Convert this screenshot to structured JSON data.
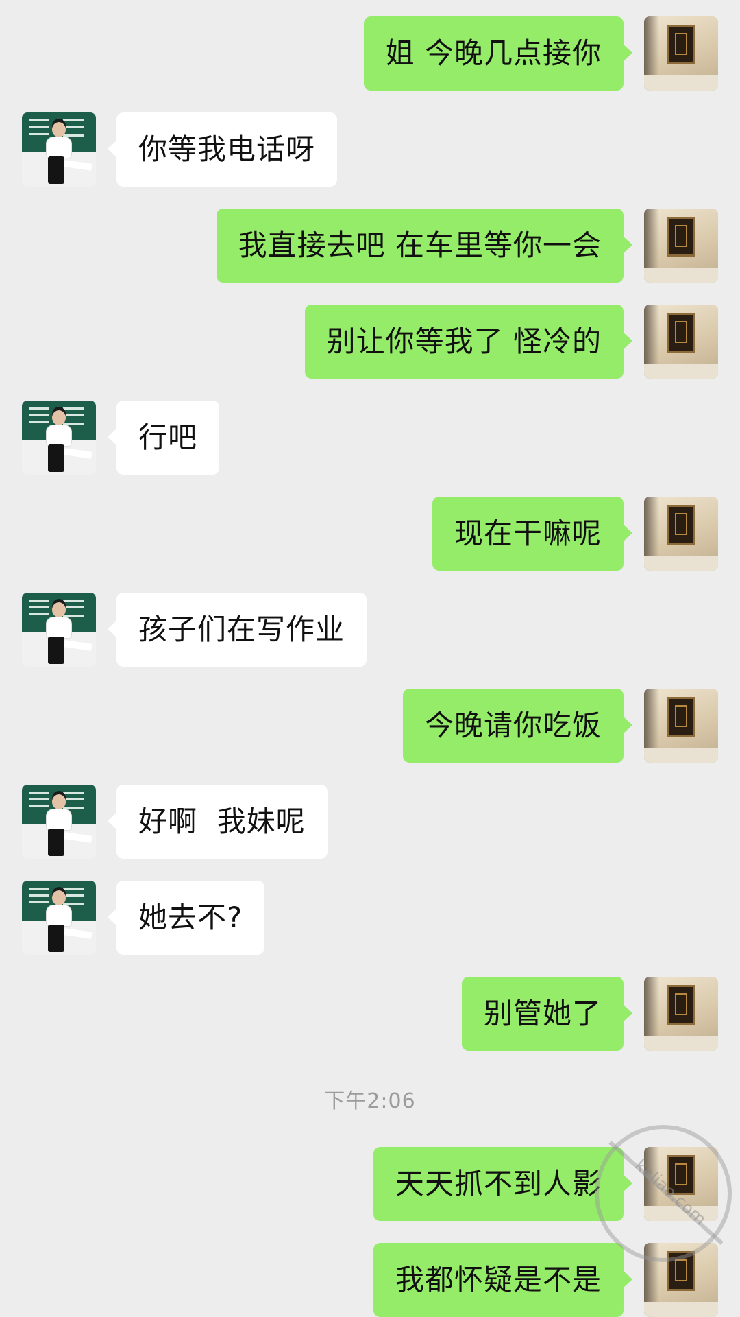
{
  "messages": [
    {
      "side": "right",
      "text": "姐 今晚几点接你"
    },
    {
      "side": "left",
      "text": "你等我电话呀"
    },
    {
      "side": "right",
      "text": "我直接去吧 在车里等你一会"
    },
    {
      "side": "right",
      "text": "别让你等我了 怪冷的"
    },
    {
      "side": "left",
      "text": "行吧"
    },
    {
      "side": "right",
      "text": "现在干嘛呢"
    },
    {
      "side": "left",
      "text": "孩子们在写作业"
    },
    {
      "side": "right",
      "text": "今晚请你吃饭"
    },
    {
      "side": "left",
      "text": "好啊  我妹呢"
    },
    {
      "side": "left",
      "text": "她去不?"
    },
    {
      "side": "right",
      "text": "别管她了"
    },
    {
      "side": "right",
      "text": "天天抓不到人影"
    },
    {
      "side": "right",
      "text": "我都怀疑是不是"
    }
  ],
  "timestamp": "下午2:06",
  "watermark": "kaliao.com",
  "colors": {
    "background": "#ededed",
    "sent_bubble": "#95ec69",
    "received_bubble": "#ffffff",
    "timestamp_text": "#9b9b9b"
  },
  "icons": {
    "self_avatar": "framed-picture-avatar",
    "other_avatar": "teacher-chalkboard-avatar"
  }
}
